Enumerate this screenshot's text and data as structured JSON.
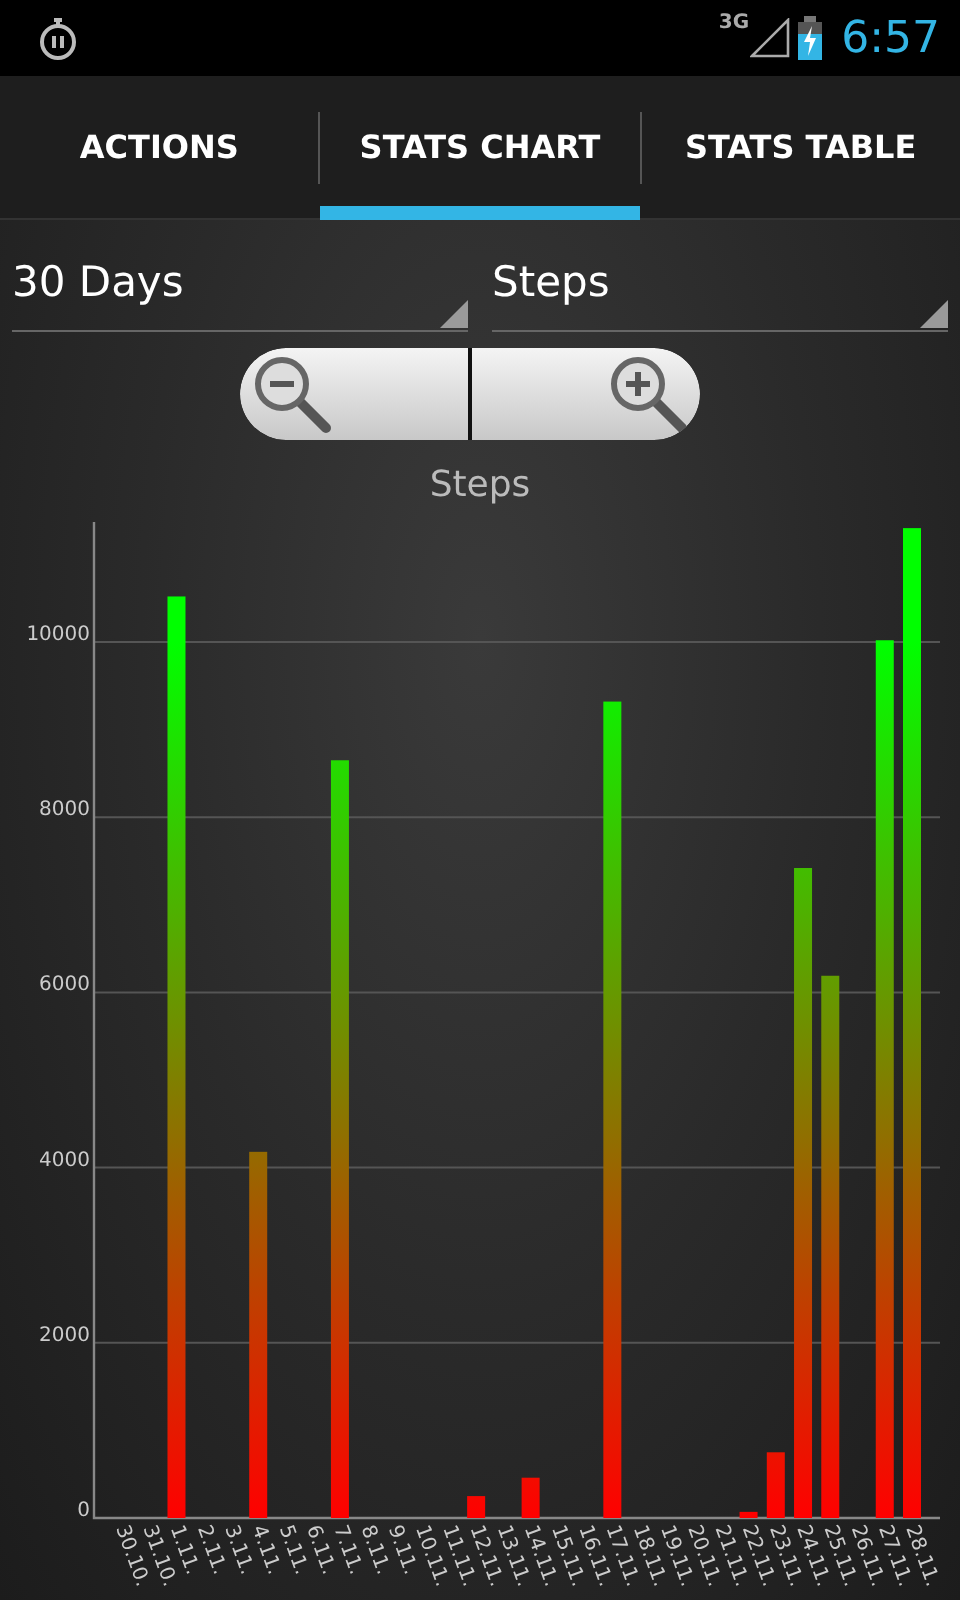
{
  "status_bar": {
    "network": "3G",
    "time": "6:57"
  },
  "tabs": [
    {
      "label": "ACTIONS",
      "selected": false
    },
    {
      "label": "STATS CHART",
      "selected": true
    },
    {
      "label": "STATS TABLE",
      "selected": false
    }
  ],
  "filters": [
    {
      "value": "30 Days"
    },
    {
      "value": "Steps"
    }
  ],
  "zoom_buttons": [
    {
      "kind": "zoom_out"
    },
    {
      "kind": "zoom_in"
    }
  ],
  "chart": {
    "chart_data": {
      "type": "bar",
      "title": "Steps",
      "categories": [
        "30.10.",
        "31.10.",
        "1.11.",
        "2.11.",
        "3.11.",
        "4.11.",
        "5.11.",
        "6.11.",
        "7.11.",
        "8.11.",
        "9.11.",
        "10.11.",
        "11.11.",
        "12.11.",
        "13.11.",
        "14.11.",
        "15.11.",
        "16.11.",
        "17.11.",
        "18.11.",
        "19.11.",
        "20.11.",
        "21.11.",
        "22.11.",
        "23.11.",
        "24.11.",
        "25.11.",
        "26.11.",
        "27.11.",
        "28.11."
      ],
      "series": [
        {
          "values": [
            0,
            0,
            10520,
            0,
            0,
            4180,
            0,
            0,
            8650,
            0,
            0,
            0,
            0,
            250,
            0,
            460,
            0,
            0,
            9320,
            0,
            0,
            0,
            0,
            70,
            750,
            7420,
            6190,
            0,
            10020,
            11300
          ]
        }
      ],
      "grid": true,
      "ylim": [
        0,
        11370
      ],
      "yticks": [
        0,
        2000,
        4000,
        6000,
        8000,
        10000
      ]
    }
  }
}
